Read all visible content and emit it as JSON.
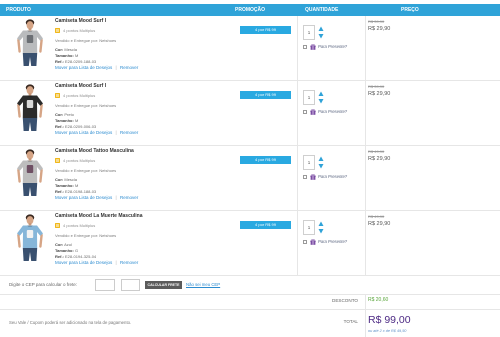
{
  "header": {
    "product": "PRODUTO",
    "promotion": "PROMOÇÃO",
    "quantity": "QUANTIDADE",
    "price": "PREÇO"
  },
  "labels": {
    "sold_by": "Vendido e Entregue por:",
    "color": "Cor:",
    "size": "Tamanho:",
    "ref": "Ref.:",
    "move_to_wishlist": "Mover para Lista de Desejos",
    "link_separator": "|",
    "remove": "Remover",
    "gift": "Para Presente?"
  },
  "items": [
    {
      "title": "Camiseta Mood Surf I",
      "points": "4 pontos Multiplus",
      "seller": "Netshoes",
      "color": "Mescla",
      "size": "M",
      "ref": "E28-0209-188-03",
      "promotion": "4 por R$ 99",
      "quantity": "1",
      "old_price": "R$ 39,90",
      "price": "R$ 29,90",
      "shirt_color": "#b9bbbd",
      "print_color": "#6b6f74"
    },
    {
      "title": "Camiseta Mood Surf I",
      "points": "4 pontos Multiplus",
      "seller": "Netshoes",
      "color": "Preto",
      "size": "M",
      "ref": "E28-0209-006-03",
      "promotion": "4 por R$ 99",
      "quantity": "1",
      "old_price": "R$ 39,90",
      "price": "R$ 29,90",
      "shirt_color": "#2b2b2b",
      "print_color": "#d9d9d9"
    },
    {
      "title": "Camiseta Mood Tattoo Masculina",
      "points": "4 pontos Multiplus",
      "seller": "Netshoes",
      "color": "Mescla",
      "size": "M",
      "ref": "E28-0198-188-03",
      "promotion": "4 por R$ 99",
      "quantity": "1",
      "old_price": "R$ 49,90",
      "price": "R$ 29,90",
      "shirt_color": "#bdbdbd",
      "print_color": "#6e4f63"
    },
    {
      "title": "Camiseta Mood La Muerte Masculina",
      "points": "4 pontos Multiplus",
      "seller": "Netshoes",
      "color": "Azul",
      "size": "G",
      "ref": "E28-0194-325-04",
      "promotion": "4 por R$ 99",
      "quantity": "1",
      "old_price": "R$ 49,90",
      "price": "R$ 29,90",
      "shirt_color": "#86b6d9",
      "print_color": "#f2f2f2"
    }
  ],
  "shipping": {
    "label": "Digite o CEP para calcular o frete:",
    "button": "CALCULAR FRETE",
    "help_link": "Não sei meu CEP"
  },
  "summary": {
    "discount_label": "DESCONTO",
    "discount": "R$ 20,60",
    "voucher_note": "Seu Vale / Cupom poderá ser adicionado na tela de pagamento.",
    "total_label": "TOTAL",
    "total": "R$ 99,00",
    "installments": "ou até 2 x de R$ 49,50"
  },
  "icons": {
    "points": "multiplus-icon",
    "quantity_up": "arrow-up-icon",
    "quantity_down": "arrow-down-icon",
    "gift": "gift-icon"
  },
  "colors": {
    "header": "#2fa3d8",
    "link": "#2b8bd0",
    "promo_button": "#29a9e1",
    "discount": "#5aa63c",
    "total": "#4d2a84",
    "gift_icon": "#7b4ea3",
    "quantity_arrows": "#2fa3d8",
    "points_icon": "#f0b81c",
    "button": "#5b5b5b"
  }
}
